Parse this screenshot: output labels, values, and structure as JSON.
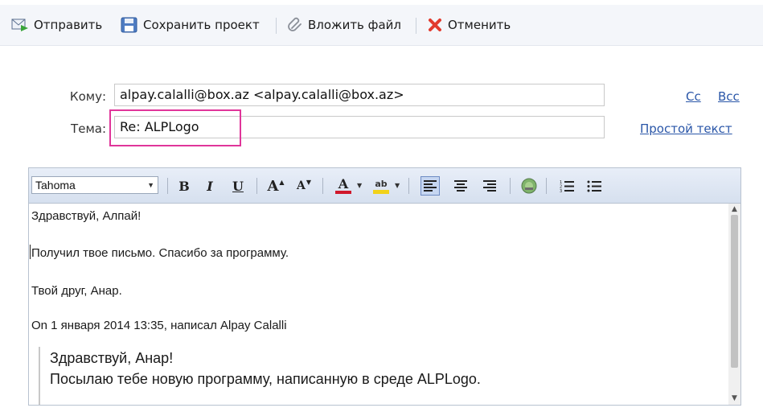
{
  "toolbar": {
    "send_label": "Отправить",
    "save_label": "Сохранить проект",
    "attach_label": "Вложить файл",
    "cancel_label": "Отменить"
  },
  "compose": {
    "to_label": "Кому:",
    "to_value": "alpay.calalli@box.az <alpay.calalli@box.az>",
    "subject_label": "Тема:",
    "subject_value": "Re: ALPLogo",
    "cc_link": "Cc",
    "bcc_link": "Bcc",
    "plain_text_link": "Простой текст"
  },
  "editor": {
    "font_name": "Tahoma",
    "bold": "B",
    "italic": "I",
    "underline": "U",
    "grow": "A",
    "shrink": "A",
    "font_color": "A",
    "highlight": "ab"
  },
  "body": {
    "greeting": "Здравствуй, Алпай!",
    "line1": "Получил твое письмо. Спасибо за программу.",
    "signature": "Твой друг, Анар.",
    "quote_header": "On 1 января 2014 13:35, написал Alpay Calalli",
    "quote_line1": "Здравствуй, Анар!",
    "quote_line2": "Посылаю тебе новую программу, написанную в среде ALPLogo."
  },
  "colors": {
    "highlight_box": "#e0359a",
    "link": "#2a56a8",
    "font_color_bar": "#d0182b",
    "highlight_color_bar": "#f2d21a"
  }
}
